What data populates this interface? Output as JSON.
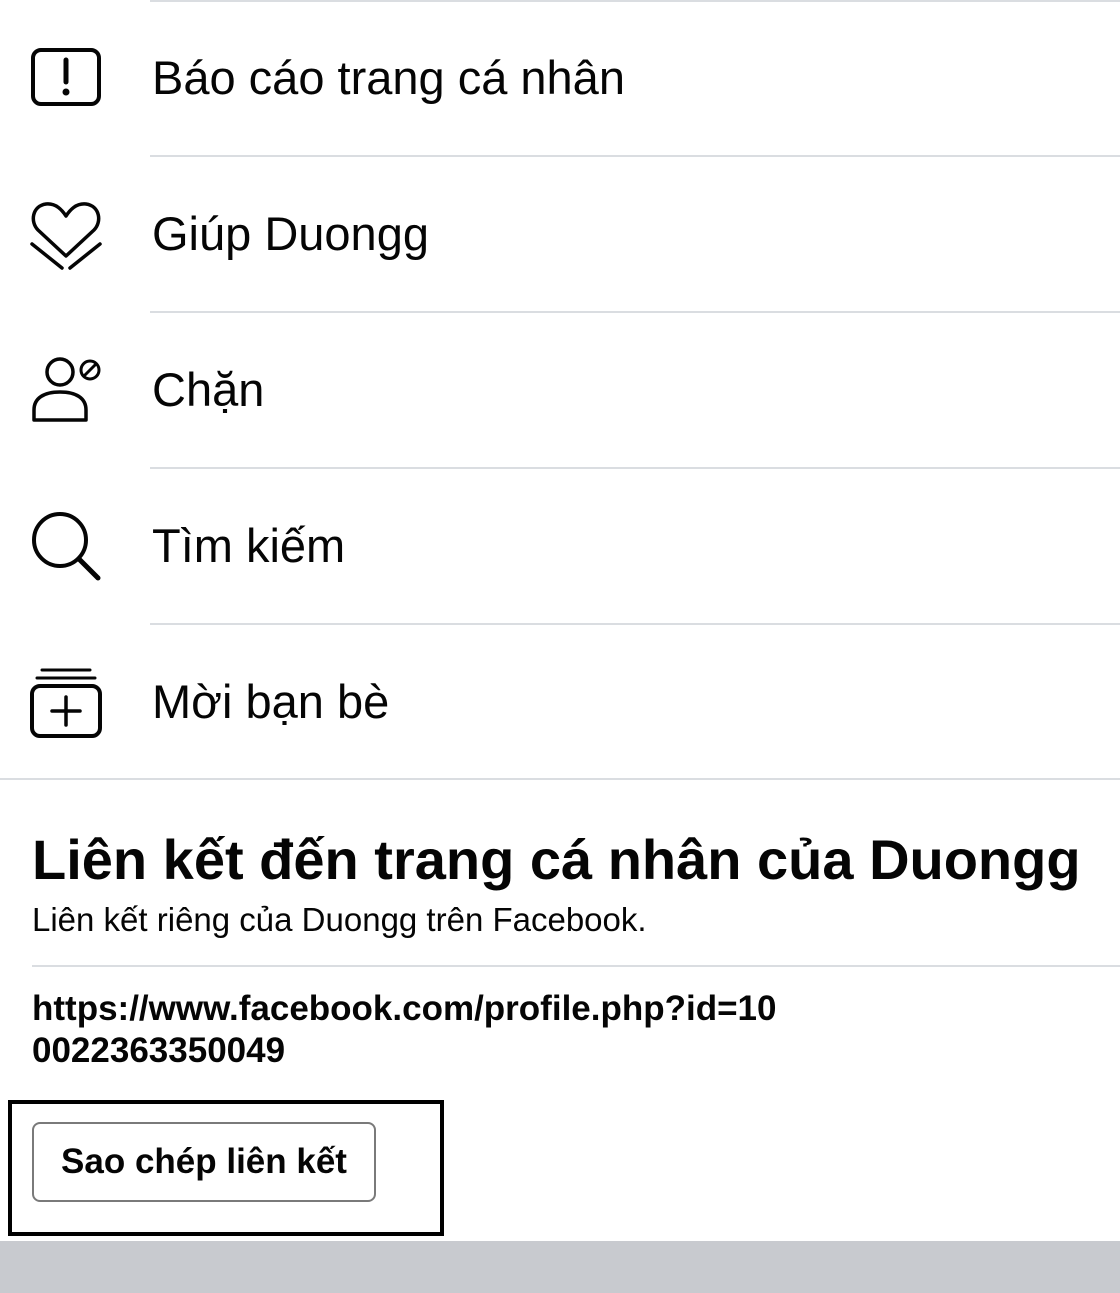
{
  "menu": {
    "items": [
      {
        "label": "Báo cáo trang cá nhân",
        "icon": "report-exclamation-icon"
      },
      {
        "label": "Giúp Duongg",
        "icon": "heart-hand-icon"
      },
      {
        "label": "Chặn",
        "icon": "block-user-icon"
      },
      {
        "label": "Tìm kiếm",
        "icon": "search-icon"
      },
      {
        "label": "Mời bạn bè",
        "icon": "invite-friends-icon"
      }
    ]
  },
  "profile_link": {
    "title": "Liên kết đến trang cá nhân của Duongg",
    "subtitle": "Liên kết riêng của Duongg trên Facebook.",
    "url": "https://www.facebook.com/profile.php?id=100022363350049",
    "copy_button_label": "Sao chép liên kết"
  },
  "colors": {
    "text": "#050505",
    "divider": "#dadde1",
    "button_border": "#7a7a7a",
    "highlight_border": "#000000",
    "bottom_bar": "#c8cacf"
  }
}
